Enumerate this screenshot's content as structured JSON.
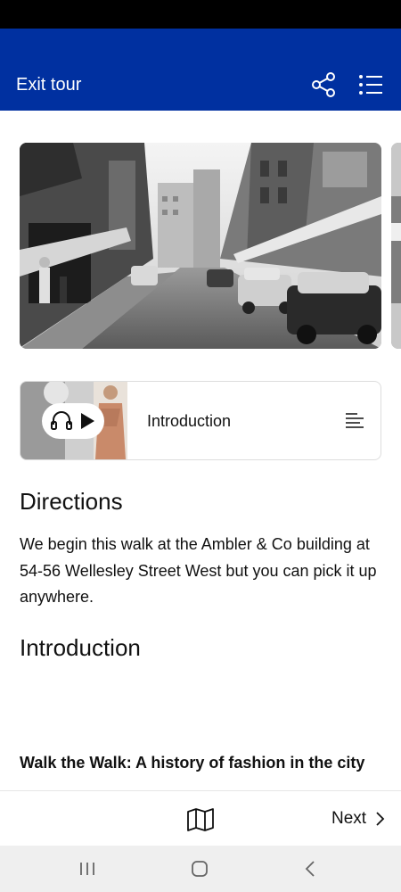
{
  "header": {
    "exit_label": "Exit tour",
    "share_icon": "share-icon",
    "menu_icon": "list-icon",
    "background_color": "#0030a0"
  },
  "hero": {
    "image": "street-photo",
    "description_icon": "black-and-white-street"
  },
  "audio_card": {
    "title": "Introduction",
    "icons": [
      "headphones-icon",
      "play-icon",
      "transcript-icon"
    ]
  },
  "directions": {
    "heading": "Directions",
    "body": "We begin this walk at the Ambler & Co building at 54-56 Wellesley Street West but you can pick it up anywhere."
  },
  "introduction": {
    "heading": "Introduction"
  },
  "walk": {
    "title": "Walk the Walk: A history of fashion in the city"
  },
  "bottom_bar": {
    "map_icon": "map-icon",
    "next_label": "Next"
  },
  "system_nav": {
    "icons": [
      "recent-apps-icon",
      "home-icon",
      "back-icon"
    ]
  }
}
